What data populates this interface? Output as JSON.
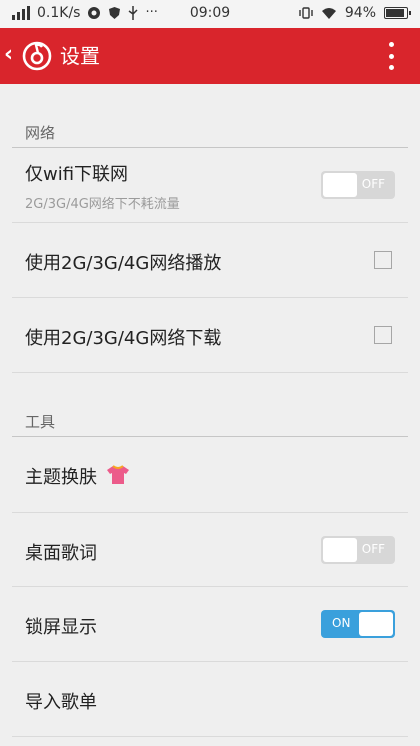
{
  "status_bar": {
    "network_speed": "0.1K/s",
    "time": "09:09",
    "battery": "94%",
    "battery_level": 0.94,
    "more_glyph": "···"
  },
  "app_bar": {
    "title": "设置"
  },
  "sections": {
    "network": {
      "title": "网络",
      "wifi_only": {
        "label": "仅wifi下联网",
        "sub": "2G/3G/4G网络下不耗流量",
        "state": "OFF"
      },
      "play_on_mobile": {
        "label": "使用2G/3G/4G网络播放",
        "checked": false
      },
      "download_on_mobile": {
        "label": "使用2G/3G/4G网络下载",
        "checked": false
      }
    },
    "tools": {
      "title": "工具",
      "theme": {
        "label": "主题换肤"
      },
      "desktop_lyrics": {
        "label": "桌面歌词",
        "state": "OFF"
      },
      "lockscreen": {
        "label": "锁屏显示",
        "state": "ON"
      },
      "import_playlist": {
        "label": "导入歌单"
      }
    }
  },
  "colors": {
    "accent": "#d9252c",
    "toggle_on": "#3aa0dc",
    "toggle_off": "#d7d7d7"
  }
}
